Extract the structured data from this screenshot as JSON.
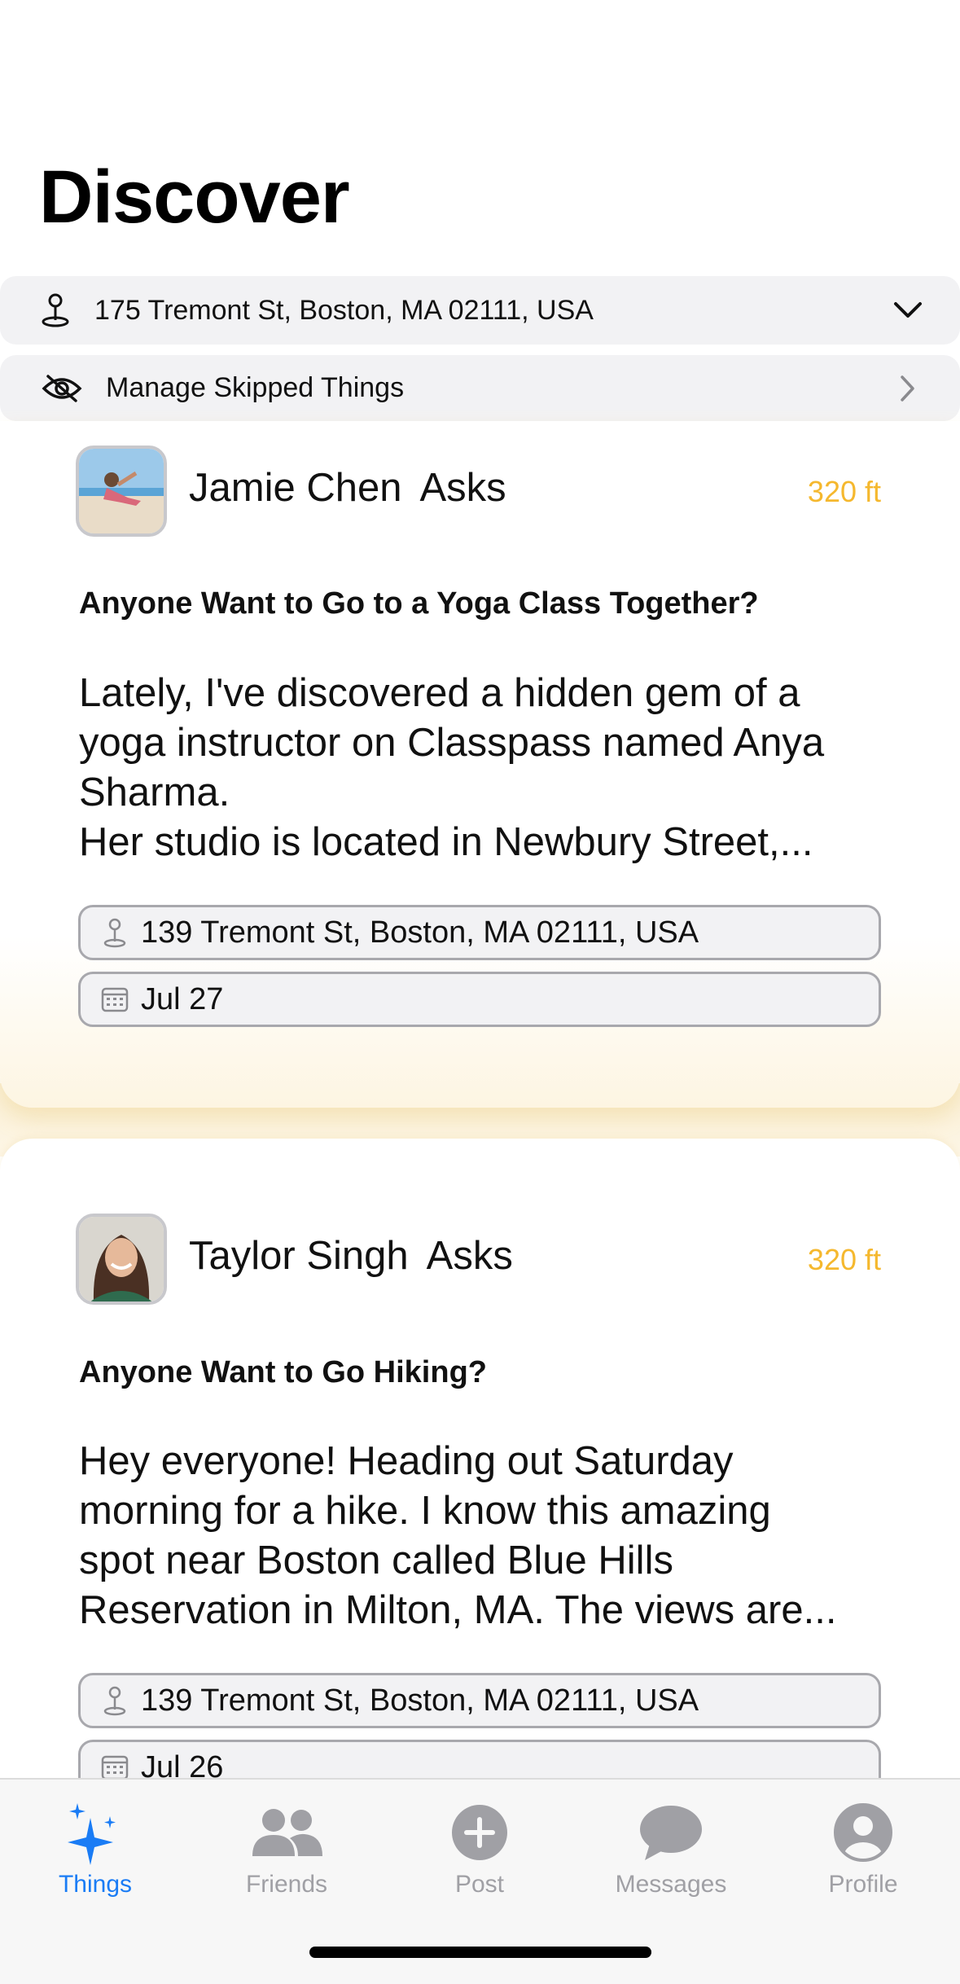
{
  "page": {
    "title": "Discover"
  },
  "location_bar": {
    "address": "175 Tremont St, Boston, MA 02111, USA",
    "icon": "location-pin-icon",
    "trail_icon": "chevron-down-icon"
  },
  "skip_bar": {
    "label": "Manage Skipped Things",
    "icon": "eye-slash-icon",
    "trail_icon": "chevron-right-icon"
  },
  "posts": [
    {
      "author": "Jamie Chen",
      "verb": "Asks",
      "distance": "320 ft",
      "title": "Anyone Want to Go to a Yoga Class Together?",
      "body": "Lately, I've discovered a hidden gem of a\nyoga instructor on Classpass named Anya\nSharma.\nHer studio is located in Newbury Street,...",
      "location": "139 Tremont St, Boston, MA 02111, USA",
      "date": "Jul 27"
    },
    {
      "author": "Taylor Singh",
      "verb": "Asks",
      "distance": "320 ft",
      "title": "Anyone Want to Go Hiking?",
      "body": "Hey everyone! Heading out Saturday\nmorning for a hike. I know this amazing\nspot near Boston called Blue Hills\nReservation in Milton, MA. The views are...",
      "location": "139 Tremont St, Boston, MA 02111, USA",
      "date": "Jul 26"
    }
  ],
  "tabs": [
    {
      "label": "Things",
      "icon": "sparkles-icon",
      "active": true
    },
    {
      "label": "Friends",
      "icon": "people-icon",
      "active": false
    },
    {
      "label": "Post",
      "icon": "plus-circle-icon",
      "active": false
    },
    {
      "label": "Messages",
      "icon": "chat-bubble-icon",
      "active": false
    },
    {
      "label": "Profile",
      "icon": "person-circle-icon",
      "active": false
    }
  ],
  "colors": {
    "accent": "#1a7cf5",
    "distance": "#f5b82e",
    "inactive_tab": "#a0a0a5"
  }
}
